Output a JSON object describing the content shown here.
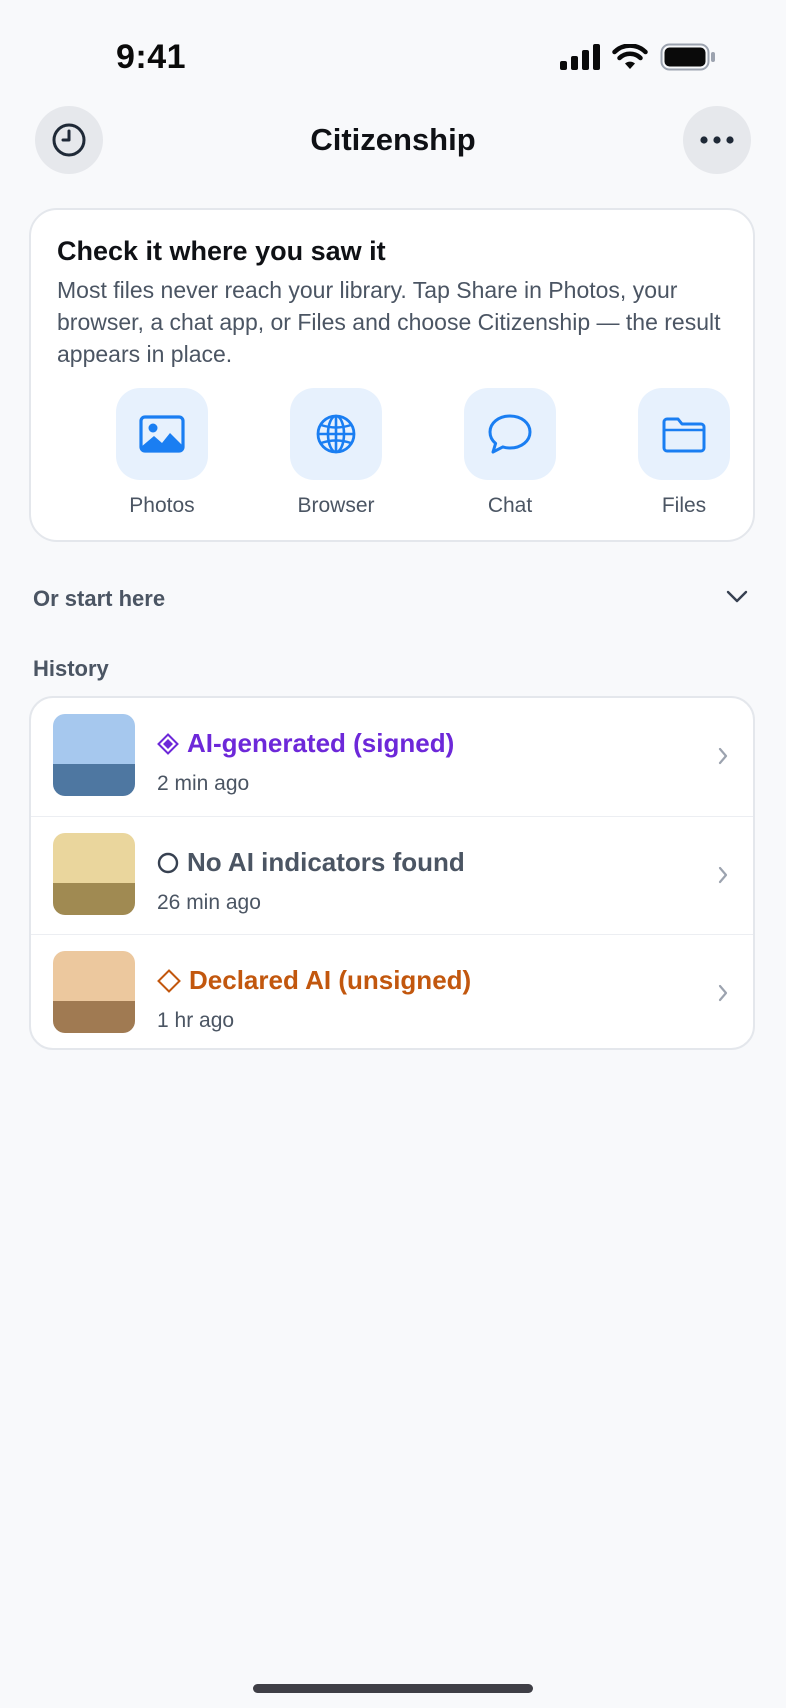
{
  "status_bar": {
    "time": "9:41"
  },
  "header": {
    "title": "Citizenship",
    "left_icon": "history-clock-icon",
    "right_icon": "more-ellipsis-icon"
  },
  "share_card": {
    "title": "Check it where you saw it",
    "description": "Most files never reach your library. Tap Share in Photos, your browser, a chat app, or Files and choose Citizenship — the result appears in place.",
    "targets": [
      {
        "label": "Photos",
        "icon": "photo-icon"
      },
      {
        "label": "Browser",
        "icon": "globe-icon"
      },
      {
        "label": "Chat",
        "icon": "chat-bubble-icon"
      },
      {
        "label": "Files",
        "icon": "folder-icon"
      }
    ],
    "accent_color": "#1a7ef2"
  },
  "start_section": {
    "label": "Or start here",
    "icon": "chevron-down-icon",
    "expanded": false
  },
  "history": {
    "heading": "History",
    "items": [
      {
        "title": "AI-generated (signed)",
        "time": "2 min ago",
        "badge_icon": "filled-diamond-icon",
        "color": "#6d28d9",
        "thumb_top": "#a6c8ee",
        "thumb_bottom": "#4e77a1"
      },
      {
        "title": "No AI indicators found",
        "time": "26 min ago",
        "badge_icon": "circle-outline-icon",
        "color": "#4b5563",
        "thumb_top": "#ead69d",
        "thumb_bottom": "#a08a52"
      },
      {
        "title": "Declared AI (unsigned)",
        "time": "1 hr ago",
        "badge_icon": "diamond-outline-icon",
        "color": "#c2570e",
        "thumb_top": "#ecc89e",
        "thumb_bottom": "#a07a52"
      }
    ]
  }
}
